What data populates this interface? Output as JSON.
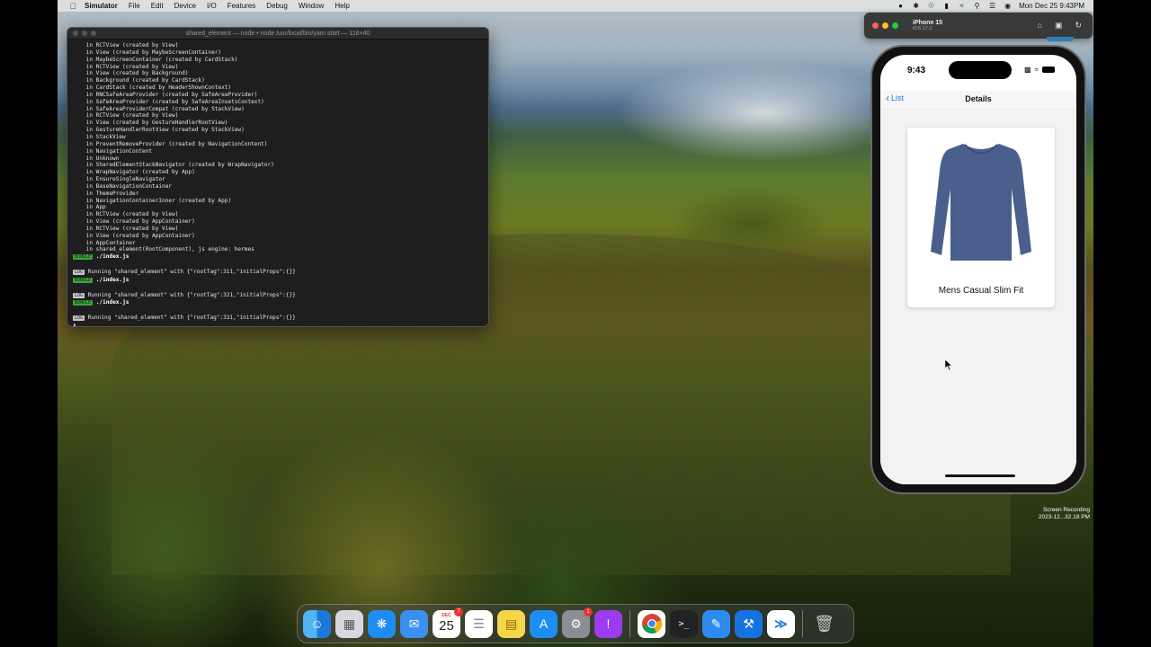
{
  "menubar": {
    "app_name": "Simulator",
    "menus": [
      "File",
      "Edit",
      "Device",
      "I/O",
      "Features",
      "Debug",
      "Window",
      "Help"
    ],
    "clock": "Mon Dec 25  9:43PM"
  },
  "terminal": {
    "title": "shared_element — node • node /usr/local/bin/yarn start — 118×40",
    "lines": [
      "    in RCTView (created by View)",
      "    in View (created by MaybeScreenContainer)",
      "    in MaybeScreenContainer (created by CardStack)",
      "    in RCTView (created by View)",
      "    in View (created by Background)",
      "    in Background (created by CardStack)",
      "    in CardStack (created by HeaderShownContext)",
      "    in RNCSafeAreaProvider (created by SafeAreaProvider)",
      "    in SafeAreaProvider (created by SafeAreaInsetsContext)",
      "    in SafeAreaProviderCompat (created by StackView)",
      "    in RCTView (created by View)",
      "    in View (created by GestureHandlerRootView)",
      "    in GestureHandlerRootView (created by StackView)",
      "    in StackView",
      "    in PreventRemoveProvider (created by NavigationContent)",
      "    in NavigationContent",
      "    in Unknown",
      "    in SharedElementStackNavigator (created by WrapNavigator)",
      "    in WrapNavigator (created by App)",
      "    in EnsureSingleNavigator",
      "    in BaseNavigationContainer",
      "    in ThemeProvider",
      "    in NavigationContainerInner (created by App)",
      "    in App",
      "    in RCTView (created by View)",
      "    in View (created by AppContainer)",
      "    in RCTView (created by View)",
      "    in View (created by AppContainer)",
      "    in AppContainer",
      "    in shared_element(RootComponent), js engine: hermes"
    ],
    "bundle_tag": "BUNDLE",
    "log_tag": "LOG",
    "bundle_file": "./index.js",
    "log_1": "Running \"shared_element\" with {\"rootTag\":311,\"initialProps\":{}}",
    "log_2": "Running \"shared_element\" with {\"rootTag\":321,\"initialProps\":{}}",
    "log_3": "Running \"shared_element\" with {\"rootTag\":331,\"initialProps\":{}}"
  },
  "simulator": {
    "device_name": "iPhone 15",
    "device_os": "iOS 17.2"
  },
  "phone": {
    "time": "9:43",
    "back_label": "List",
    "nav_title": "Details",
    "product_name": "Mens Casual Slim Fit",
    "shirt_color": "#4a5f8c"
  },
  "recording": {
    "line1": "Screen Recording",
    "line2": "2023-12...32.18 PM"
  },
  "dock": {
    "calendar_month": "DEC",
    "calendar_day": "25",
    "calendar_badge": "7",
    "settings_badge": "1"
  }
}
